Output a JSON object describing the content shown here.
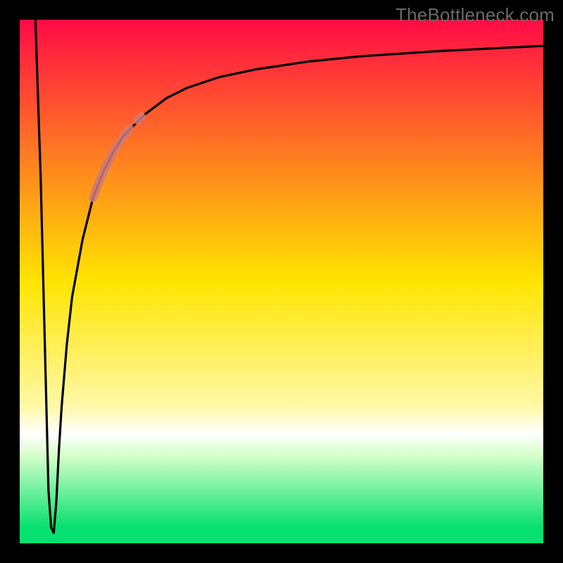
{
  "watermark": "TheBottleneck.com",
  "chart_data": {
    "type": "line",
    "title": "",
    "xlabel": "",
    "ylabel": "",
    "xlim": [
      0,
      100
    ],
    "ylim": [
      0,
      100
    ],
    "grid": false,
    "legend": false,
    "gradient_stops": [
      {
        "offset": 0.0,
        "color": "#ff0b45"
      },
      {
        "offset": 0.5,
        "color": "#ffe500"
      },
      {
        "offset": 0.74,
        "color": "#fff8a8"
      },
      {
        "offset": 0.79,
        "color": "#ffffff"
      },
      {
        "offset": 0.83,
        "color": "#d9ffcc"
      },
      {
        "offset": 0.97,
        "color": "#05e070"
      },
      {
        "offset": 1.0,
        "color": "#05e070"
      }
    ],
    "series": [
      {
        "name": "bottleneck-curve",
        "color": "#000000",
        "x": [
          3.0,
          4.0,
          5.0,
          5.5,
          6.0,
          6.5,
          7.0,
          7.5,
          8.0,
          9.0,
          10.0,
          12.0,
          14.0,
          16.0,
          18.0,
          20.0,
          24.0,
          28.0,
          32.0,
          38.0,
          45.0,
          55.0,
          65.0,
          80.0,
          100.0
        ],
        "y": [
          100.0,
          70.0,
          30.0,
          10.0,
          3.0,
          2.0,
          8.0,
          18.0,
          26.0,
          38.0,
          47.0,
          58.0,
          66.0,
          71.0,
          75.0,
          78.0,
          82.0,
          85.0,
          87.0,
          89.0,
          90.5,
          92.0,
          93.0,
          94.0,
          95.0
        ]
      },
      {
        "name": "highlight-segment",
        "color": "#cf7a7a",
        "thick": true,
        "x": [
          14.0,
          15.0,
          16.0,
          17.0,
          18.0,
          19.0,
          20.0,
          21.0
        ],
        "y": [
          66.0,
          68.7,
          71.0,
          73.2,
          75.0,
          76.6,
          78.0,
          79.2
        ]
      },
      {
        "name": "highlight-dot",
        "color": "#cf7a7a",
        "thick": true,
        "x": [
          22.5,
          23.2
        ],
        "y": [
          80.8,
          81.5
        ]
      }
    ],
    "optimum_x": 6.2,
    "optimum_y": 2.0
  }
}
